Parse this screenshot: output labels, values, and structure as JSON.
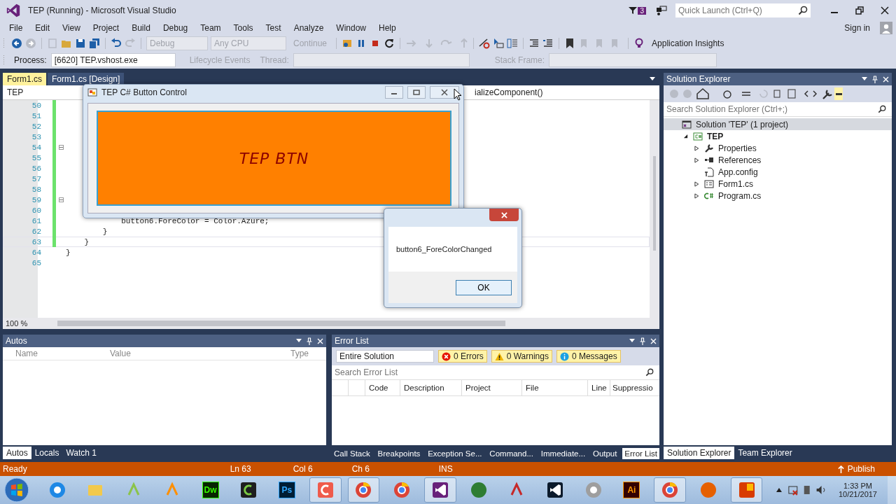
{
  "window": {
    "title": "TEP (Running) - Microsoft Visual Studio",
    "notifications": "3",
    "quick_launch": {
      "placeholder": "Quick Launch (Ctrl+Q)"
    },
    "sign_in": "Sign in"
  },
  "menu": [
    "File",
    "Edit",
    "View",
    "Project",
    "Build",
    "Debug",
    "Team",
    "Tools",
    "Test",
    "Analyze",
    "Window",
    "Help"
  ],
  "toolbar": {
    "configuration": "Debug",
    "platform": "Any CPU",
    "continue": "Continue",
    "insights": "Application Insights"
  },
  "debug_location": {
    "process_label": "Process:",
    "process": "[6620] TEP.vshost.exe",
    "lifecycle": "Lifecycle Events",
    "thread_label": "Thread:",
    "stack_frame_label": "Stack Frame:"
  },
  "editor": {
    "tabs": [
      {
        "label": "Form1.cs",
        "selected": true
      },
      {
        "label": "Form1.cs [Design]",
        "selected": false
      }
    ],
    "nav_project": "TEP",
    "nav_member": "ializeComponent()",
    "zoom": "100 %",
    "lines": [
      {
        "number": "50",
        "changed": true,
        "fold": false,
        "current": false
      },
      {
        "number": "51",
        "changed": true,
        "fold": false,
        "current": false
      },
      {
        "number": "52",
        "changed": true,
        "fold": false,
        "current": false
      },
      {
        "number": "53",
        "changed": true,
        "fold": false,
        "current": false
      },
      {
        "number": "54",
        "changed": true,
        "fold": true,
        "current": false
      },
      {
        "number": "55",
        "changed": true,
        "fold": false,
        "current": false
      },
      {
        "number": "56",
        "changed": true,
        "fold": false,
        "current": false
      },
      {
        "number": "57",
        "changed": true,
        "fold": false,
        "current": false
      },
      {
        "number": "58",
        "changed": true,
        "fold": false,
        "current": false
      },
      {
        "number": "59",
        "changed": true,
        "fold": true,
        "current": false
      },
      {
        "number": "60",
        "changed": true,
        "fold": false,
        "current": false
      },
      {
        "number": "61",
        "code": "            button6.ForeColor = Color.Azure;",
        "changed": true,
        "fold": false,
        "current": false
      },
      {
        "number": "62",
        "code": "        }",
        "changed": true,
        "fold": false,
        "current": false
      },
      {
        "number": "63",
        "code": "    }",
        "changed": true,
        "fold": false,
        "current": true
      },
      {
        "number": "64",
        "code": "}",
        "changed": false,
        "fold": false,
        "current": false
      },
      {
        "number": "65",
        "changed": false,
        "fold": false,
        "current": false
      }
    ]
  },
  "form_window": {
    "title": "TEP C# Button Control",
    "button": "TEP BTN"
  },
  "message_box": {
    "text": "button6_ForeColorChanged",
    "ok": "OK"
  },
  "autos": {
    "title": "Autos",
    "columns": [
      "Name",
      "Value",
      "Type"
    ],
    "tabs": [
      {
        "label": "Autos",
        "selected": true
      },
      {
        "label": "Locals",
        "selected": false
      },
      {
        "label": "Watch 1",
        "selected": false
      }
    ]
  },
  "error_list": {
    "title": "Error List",
    "scope": "Entire Solution",
    "filters": [
      {
        "kind": "error",
        "label": "0 Errors",
        "selected": true
      },
      {
        "kind": "warning",
        "label": "0 Warnings",
        "selected": true
      },
      {
        "kind": "info",
        "label": "0 Messages",
        "selected": true
      }
    ],
    "search": {
      "placeholder": "Search Error List"
    },
    "columns": [
      "Code",
      "Description",
      "Project",
      "File",
      "Line",
      "Suppressio"
    ],
    "tabs": [
      {
        "label": "Call Stack",
        "selected": false
      },
      {
        "label": "Breakpoints",
        "selected": false
      },
      {
        "label": "Exception Se...",
        "selected": false
      },
      {
        "label": "Command...",
        "selected": false
      },
      {
        "label": "Immediate...",
        "selected": false
      },
      {
        "label": "Output",
        "selected": false
      },
      {
        "label": "Error List",
        "selected": true
      }
    ]
  },
  "solution_explorer": {
    "title": "Solution Explorer",
    "search": {
      "placeholder": "Search Solution Explorer (Ctrl+;)"
    },
    "tree": [
      {
        "label": "Solution 'TEP' (1 project)",
        "kind": "solution",
        "selected": true,
        "children": [
          {
            "label": "TEP",
            "kind": "project",
            "selected": false,
            "expanded": true,
            "children": [
              {
                "label": "Properties",
                "kind": "properties",
                "selected": false,
                "expanded": false
              },
              {
                "label": "References",
                "kind": "references",
                "selected": false,
                "expanded": false
              },
              {
                "label": "App.config",
                "kind": "config",
                "selected": false
              },
              {
                "label": "Form1.cs",
                "kind": "form",
                "selected": false,
                "expanded": false
              },
              {
                "label": "Program.cs",
                "kind": "csharp",
                "selected": false,
                "expanded": false
              }
            ]
          }
        ]
      }
    ],
    "tabs": [
      {
        "label": "Solution Explorer",
        "selected": true
      },
      {
        "label": "Team Explorer",
        "selected": false
      }
    ]
  },
  "status_bar": {
    "state": "Ready",
    "line": "Ln 63",
    "col": "Col 6",
    "ch": "Ch 6",
    "mode": "INS",
    "publish": "Publish"
  },
  "taskbar": {
    "apps": [
      {
        "kind": "ie",
        "active": false
      },
      {
        "kind": "folder",
        "active": false
      },
      {
        "kind": "android",
        "active": false
      },
      {
        "kind": "audio",
        "active": false
      },
      {
        "kind": "dw",
        "label": "Dw",
        "active": false
      },
      {
        "kind": "camtasia",
        "active": false
      },
      {
        "kind": "ps",
        "label": "Ps",
        "active": false
      },
      {
        "kind": "recorder",
        "active": true
      },
      {
        "kind": "chrome",
        "active": true
      },
      {
        "kind": "chrome",
        "active": false
      },
      {
        "kind": "vs",
        "active": true
      },
      {
        "kind": "download",
        "active": false
      },
      {
        "kind": "scissors",
        "active": false
      },
      {
        "kind": "vscode",
        "active": false
      },
      {
        "kind": "gear",
        "active": false
      },
      {
        "kind": "ai",
        "label": "Ai",
        "active": false
      },
      {
        "kind": "chrome",
        "active": true
      },
      {
        "kind": "firefox",
        "active": false
      },
      {
        "kind": "office",
        "active": true
      }
    ],
    "time": "1:33 PM",
    "date": "10/21/2017"
  }
}
